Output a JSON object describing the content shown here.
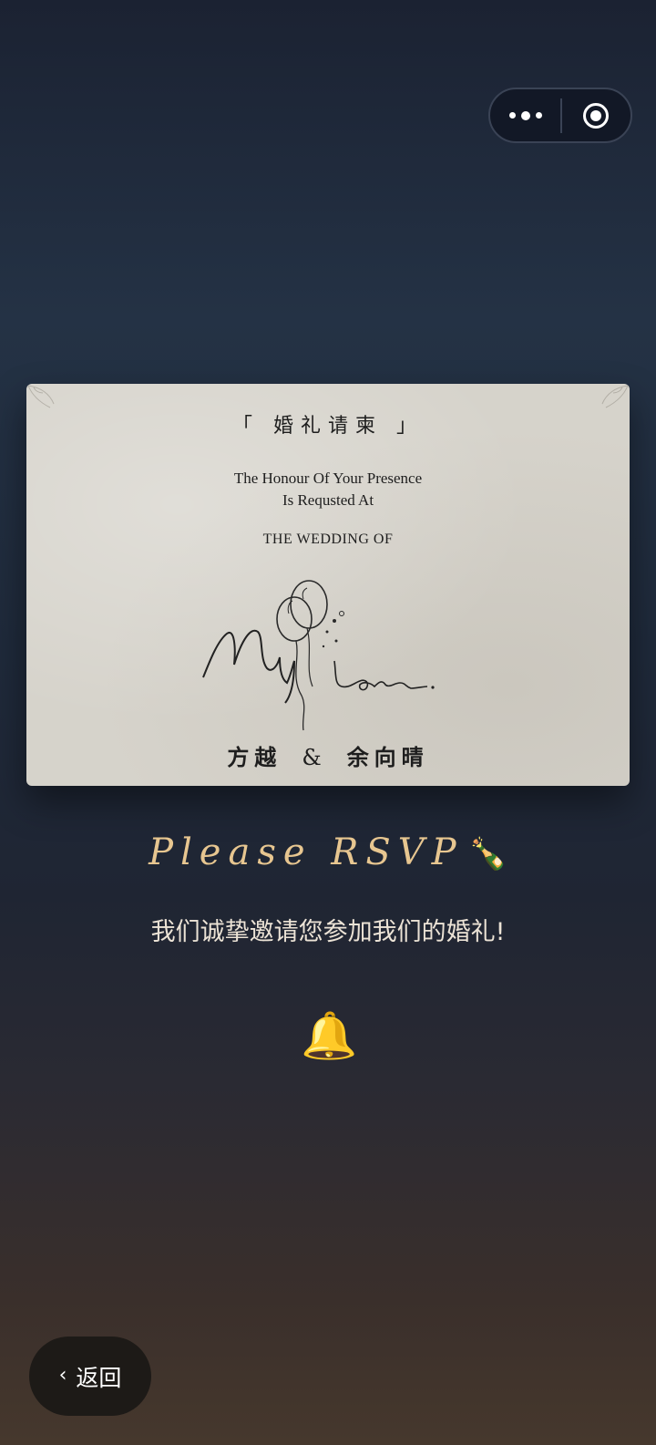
{
  "capsule": {
    "menu_icon": "more-dots-icon",
    "close_icon": "target-close-icon"
  },
  "card": {
    "title_zh": "「 婚礼请柬 」",
    "honour_line1": "The Honour Of Your Presence",
    "honour_line2": "Is Requsted At",
    "wedding_of": "THE WEDDING OF",
    "sketch_text": "My Love.",
    "name_left": "方越",
    "amp": "&",
    "name_right": "余向晴"
  },
  "rsvp": {
    "heading": "Please RSVP",
    "emoji": "🍾"
  },
  "subtitle": "我们诚挚邀请您参加我们的婚礼!",
  "bell": {
    "emoji": "🔔",
    "icon": "bell-icon"
  },
  "back": {
    "icon": "chevron-left-icon",
    "chevron": "‹",
    "label": "返回"
  }
}
